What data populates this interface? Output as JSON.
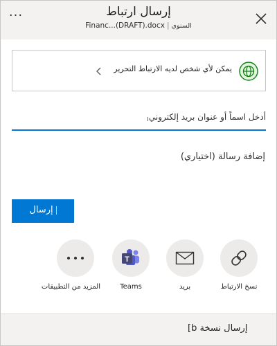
{
  "header": {
    "title": "إرسال ارتباط",
    "file_name": "Financ...(DRAFT).docx",
    "owner": "السنوي",
    "more_glyph": "···",
    "close_glyph": "×"
  },
  "link_settings": {
    "text": "يمكن لأي شخص لديه الارتباط التحرير",
    "icon": "globe-icon"
  },
  "recipient": {
    "placeholder": "أدخل اسماً أو عنوان بريد إلكتروني"
  },
  "message": {
    "placeholder": "إضافة رسالة (اختياري)"
  },
  "send_button": {
    "label": "إرسال"
  },
  "share_options": [
    {
      "label": "نسخ الارتباط",
      "icon": "link-icon"
    },
    {
      "label": "بريد",
      "icon": "mail-icon"
    },
    {
      "label": "Teams",
      "icon": "teams-icon"
    },
    {
      "label": "المزيد من التطبيقات",
      "icon": "more-apps-icon"
    }
  ],
  "footer": {
    "text": "[b إرسال نسخة"
  },
  "colors": {
    "accent": "#0078d4",
    "header_bg": "#f3f2f1",
    "globe": "#107c10",
    "teams": "#464775"
  }
}
